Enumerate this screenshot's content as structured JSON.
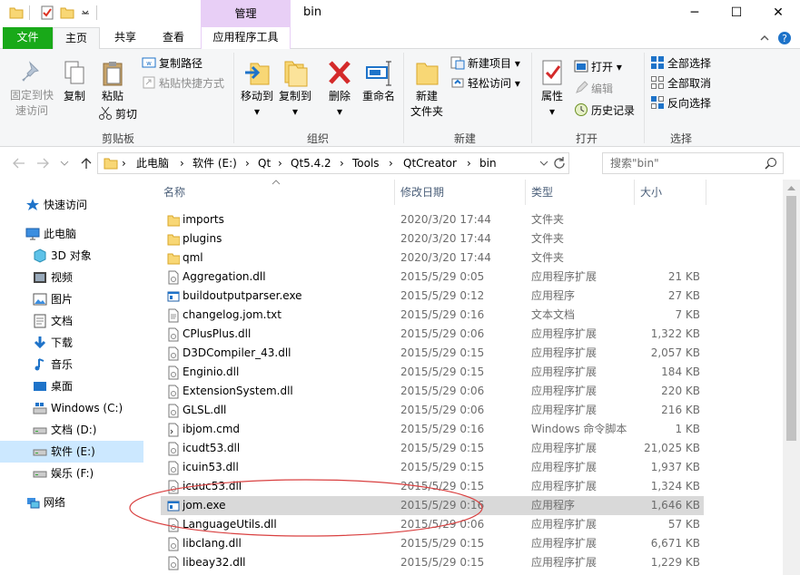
{
  "title": {
    "context_tab": "管理",
    "folder_name": "bin",
    "minimize": "─",
    "maximize": "☐",
    "close": "✕"
  },
  "tabs": {
    "file": "文件",
    "home": "主页",
    "share": "共享",
    "view": "查看",
    "app_tools": "应用程序工具"
  },
  "ribbon": {
    "pin": "固定到快",
    "pin2": "速访问",
    "copy": "复制",
    "paste": "粘贴",
    "copy_path": "复制路径",
    "paste_shortcut": "粘贴快捷方式",
    "cut": "剪切",
    "clipboard_group": "剪贴板",
    "move_to": "移动到",
    "copy_to": "复制到",
    "delete": "删除",
    "rename": "重命名",
    "organize_group": "组织",
    "new_folder": "新建",
    "new_folder2": "文件夹",
    "new_item": "新建项目",
    "easy_access": "轻松访问",
    "new_group": "新建",
    "properties": "属性",
    "open": "打开",
    "edit": "编辑",
    "history": "历史记录",
    "open_group": "打开",
    "select_all": "全部选择",
    "select_none": "全部取消",
    "invert_selection": "反向选择",
    "select_group": "选择"
  },
  "address": {
    "crumbs": [
      "此电脑",
      "软件 (E:)",
      "Qt",
      "Qt5.4.2",
      "Tools",
      "QtCreator",
      "bin"
    ],
    "search_placeholder": "搜索\"bin\""
  },
  "nav": {
    "quick_access": "快速访问",
    "this_pc": "此电脑",
    "objects3d": "3D 对象",
    "videos": "视频",
    "pictures": "图片",
    "documents": "文档",
    "downloads": "下载",
    "music": "音乐",
    "desktop": "桌面",
    "drive_c": "Windows (C:)",
    "drive_d": "文档 (D:)",
    "drive_e": "软件 (E:)",
    "drive_f": "娱乐 (F:)",
    "network": "网络"
  },
  "columns": {
    "name": "名称",
    "date": "修改日期",
    "type": "类型",
    "size": "大小"
  },
  "files": [
    {
      "name": "imports",
      "date": "2020/3/20 17:44",
      "type": "文件夹",
      "size": "",
      "kind": "folder"
    },
    {
      "name": "plugins",
      "date": "2020/3/20 17:44",
      "type": "文件夹",
      "size": "",
      "kind": "folder"
    },
    {
      "name": "qml",
      "date": "2020/3/20 17:44",
      "type": "文件夹",
      "size": "",
      "kind": "folder"
    },
    {
      "name": "Aggregation.dll",
      "date": "2015/5/29 0:05",
      "type": "应用程序扩展",
      "size": "21 KB",
      "kind": "dll"
    },
    {
      "name": "buildoutputparser.exe",
      "date": "2015/5/29 0:12",
      "type": "应用程序",
      "size": "27 KB",
      "kind": "exe"
    },
    {
      "name": "changelog.jom.txt",
      "date": "2015/5/29 0:16",
      "type": "文本文档",
      "size": "7 KB",
      "kind": "txt"
    },
    {
      "name": "CPlusPlus.dll",
      "date": "2015/5/29 0:06",
      "type": "应用程序扩展",
      "size": "1,322 KB",
      "kind": "dll"
    },
    {
      "name": "D3DCompiler_43.dll",
      "date": "2015/5/29 0:15",
      "type": "应用程序扩展",
      "size": "2,057 KB",
      "kind": "dll"
    },
    {
      "name": "Enginio.dll",
      "date": "2015/5/29 0:15",
      "type": "应用程序扩展",
      "size": "184 KB",
      "kind": "dll"
    },
    {
      "name": "ExtensionSystem.dll",
      "date": "2015/5/29 0:06",
      "type": "应用程序扩展",
      "size": "220 KB",
      "kind": "dll"
    },
    {
      "name": "GLSL.dll",
      "date": "2015/5/29 0:06",
      "type": "应用程序扩展",
      "size": "216 KB",
      "kind": "dll"
    },
    {
      "name": "ibjom.cmd",
      "date": "2015/5/29 0:16",
      "type": "Windows 命令脚本",
      "size": "1 KB",
      "kind": "cmd"
    },
    {
      "name": "icudt53.dll",
      "date": "2015/5/29 0:15",
      "type": "应用程序扩展",
      "size": "21,025 KB",
      "kind": "dll"
    },
    {
      "name": "icuin53.dll",
      "date": "2015/5/29 0:15",
      "type": "应用程序扩展",
      "size": "1,937 KB",
      "kind": "dll"
    },
    {
      "name": "icuuc53.dll",
      "date": "2015/5/29 0:15",
      "type": "应用程序扩展",
      "size": "1,324 KB",
      "kind": "dll"
    },
    {
      "name": "jom.exe",
      "date": "2015/5/29 0:16",
      "type": "应用程序",
      "size": "1,646 KB",
      "kind": "exe",
      "selected": true
    },
    {
      "name": "LanguageUtils.dll",
      "date": "2015/5/29 0:06",
      "type": "应用程序扩展",
      "size": "57 KB",
      "kind": "dll"
    },
    {
      "name": "libclang.dll",
      "date": "2015/5/29 0:15",
      "type": "应用程序扩展",
      "size": "6,671 KB",
      "kind": "dll"
    },
    {
      "name": "libeay32.dll",
      "date": "2015/5/29 0:15",
      "type": "应用程序扩展",
      "size": "1,229 KB",
      "kind": "dll"
    }
  ],
  "colors": {
    "file_tab": "#19a919",
    "context_tab": "#e8cff6",
    "selection": "#cce8ff",
    "annotation": "#d94040"
  }
}
